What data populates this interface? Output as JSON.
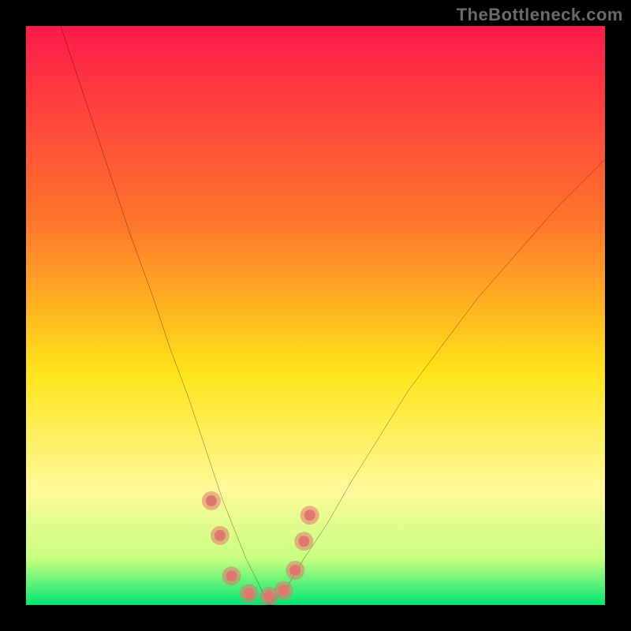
{
  "attribution": "TheBottleneck.com",
  "chart_data": {
    "type": "line",
    "title": "",
    "xlabel": "",
    "ylabel": "",
    "xlim": [
      0,
      100
    ],
    "ylim": [
      0,
      100
    ],
    "grid": false,
    "background_gradient": {
      "stops": [
        {
          "offset": 0.0,
          "color": "#ff1a4b"
        },
        {
          "offset": 0.35,
          "color": "#ff7a2a"
        },
        {
          "offset": 0.6,
          "color": "#ffe41a"
        },
        {
          "offset": 0.8,
          "color": "#fff99a"
        },
        {
          "offset": 0.92,
          "color": "#c8ff80"
        },
        {
          "offset": 1.0,
          "color": "#00e673"
        }
      ]
    },
    "series": [
      {
        "name": "left-curve",
        "stroke": "#000000",
        "stroke_width": 2.2,
        "x": [
          6,
          10,
          14,
          18,
          22,
          25,
          28,
          30,
          32,
          34,
          36,
          38,
          40,
          42
        ],
        "values": [
          100,
          88,
          76,
          64,
          53,
          44,
          36,
          30,
          24,
          18,
          13,
          8,
          4,
          0
        ]
      },
      {
        "name": "right-curve",
        "stroke": "#000000",
        "stroke_width": 2.2,
        "x": [
          42,
          45,
          48,
          52,
          56,
          61,
          66,
          72,
          78,
          85,
          92,
          100
        ],
        "values": [
          0,
          3,
          8,
          14,
          21,
          29,
          37,
          45,
          53,
          61,
          69,
          77
        ]
      }
    ],
    "markers": {
      "name": "valley-dots",
      "color": "#e0776e",
      "radius_outer": 12,
      "radius_inner": 7,
      "points": [
        {
          "x": 32.0,
          "y": 18.0
        },
        {
          "x": 33.5,
          "y": 12.0
        },
        {
          "x": 35.5,
          "y": 5.0
        },
        {
          "x": 38.5,
          "y": 2.0
        },
        {
          "x": 42.0,
          "y": 1.5
        },
        {
          "x": 44.5,
          "y": 2.5
        },
        {
          "x": 46.5,
          "y": 6.0
        },
        {
          "x": 48.0,
          "y": 11.0
        },
        {
          "x": 49.0,
          "y": 15.5
        }
      ]
    }
  }
}
